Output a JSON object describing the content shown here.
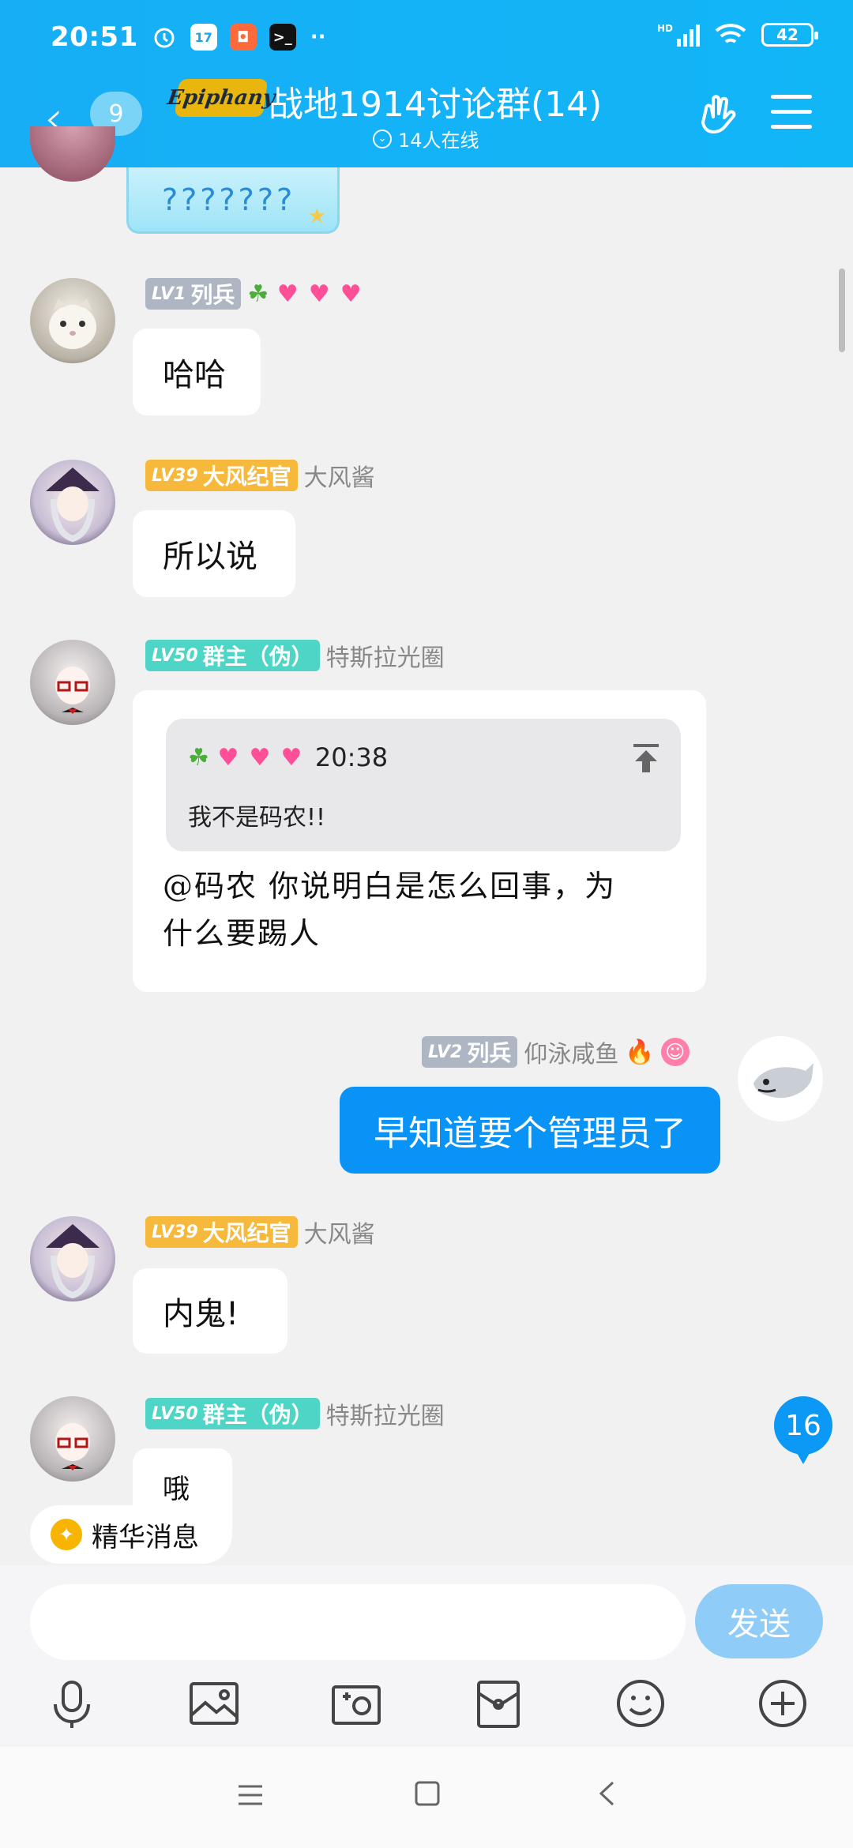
{
  "status_bar": {
    "time": "20:51",
    "icons": [
      "alarm-icon",
      "calendar-icon",
      "mall-icon",
      "terminal-icon",
      "more-dots-icon"
    ],
    "calendar_day": "17",
    "battery": "42",
    "network": "HD"
  },
  "header": {
    "back_badge": "9",
    "logo_text": "Epiphany",
    "title": "战地1914讨论群(14)",
    "online": "14人在线",
    "background": "#16b0f5"
  },
  "messages": [
    {
      "bubble": "???????"
    },
    {
      "level": "LV1",
      "title": "列兵",
      "text": "哈哈"
    },
    {
      "level": "LV39",
      "title": "大风纪官",
      "name": "大风酱",
      "text": "所以说"
    },
    {
      "level": "LV50",
      "title": "群主（伪）",
      "name": "特斯拉光圈",
      "quote": {
        "time": "20:38",
        "text": "我不是码农!!"
      },
      "text_line1": "@码农 你说明白是怎么回事，为",
      "text_line2": "什么要踢人"
    },
    {
      "level": "LV2",
      "title": "列兵",
      "name": "仰泳咸鱼",
      "text": "早知道要个管理员了"
    },
    {
      "level": "LV39",
      "title": "大风纪官",
      "name": "大风酱",
      "text": "内鬼!"
    },
    {
      "level": "LV50",
      "title": "群主（伪）",
      "name": "特斯拉光圈",
      "text": "哦"
    }
  ],
  "unread_count": "16",
  "essence_label": "精华消息",
  "input": {
    "placeholder": "",
    "send_label": "发送"
  },
  "toolbar": [
    "microphone-icon",
    "image-icon",
    "camera-icon",
    "red-packet-icon",
    "emoji-icon",
    "plus-icon"
  ],
  "colors": {
    "accent": "#0a93f7",
    "send_disabled": "#8fcdf8",
    "lv_gold": "#f7b93b",
    "lv_teal": "#4fd5c5",
    "lv_gray": "#aeb6c3"
  }
}
